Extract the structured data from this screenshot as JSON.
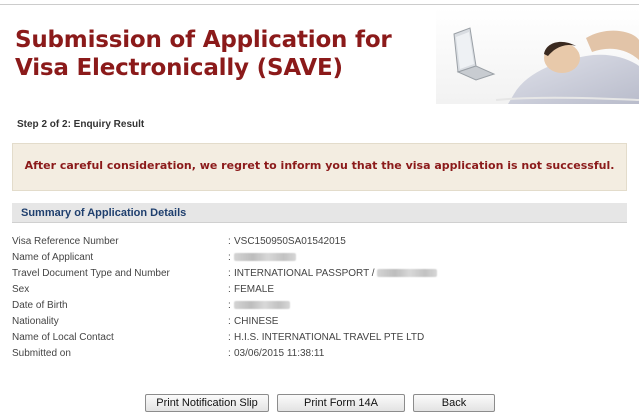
{
  "header": {
    "title": "Submission of Application for Visa Electronically (SAVE)"
  },
  "step": {
    "label": "Step 2 of 2: Enquiry Result"
  },
  "result": {
    "message": "After careful consideration, we regret to inform you that the visa application is not successful."
  },
  "summary": {
    "title": "Summary of Application Details",
    "rows": [
      {
        "label": "Visa Reference Number",
        "value": "VSC150950SA01542015"
      },
      {
        "label": "Name of Applicant",
        "value": ""
      },
      {
        "label": "Travel Document Type and Number",
        "value": "INTERNATIONAL PASSPORT /"
      },
      {
        "label": "Sex",
        "value": "FEMALE"
      },
      {
        "label": "Date of Birth",
        "value": ""
      },
      {
        "label": "Nationality",
        "value": "CHINESE"
      },
      {
        "label": "Name of Local Contact",
        "value": "H.I.S. INTERNATIONAL TRAVEL PTE LTD"
      },
      {
        "label": "Submitted on",
        "value": "03/06/2015 11:38:11"
      }
    ]
  },
  "buttons": {
    "print_slip": "Print Notification Slip",
    "print_form": "Print Form 14A",
    "back": "Back"
  },
  "colors": {
    "title": "#8b1a1a",
    "result_bg": "#f3ede1",
    "summary_header_bg": "#e6e6e6",
    "summary_header_text": "#1f3f6e"
  }
}
